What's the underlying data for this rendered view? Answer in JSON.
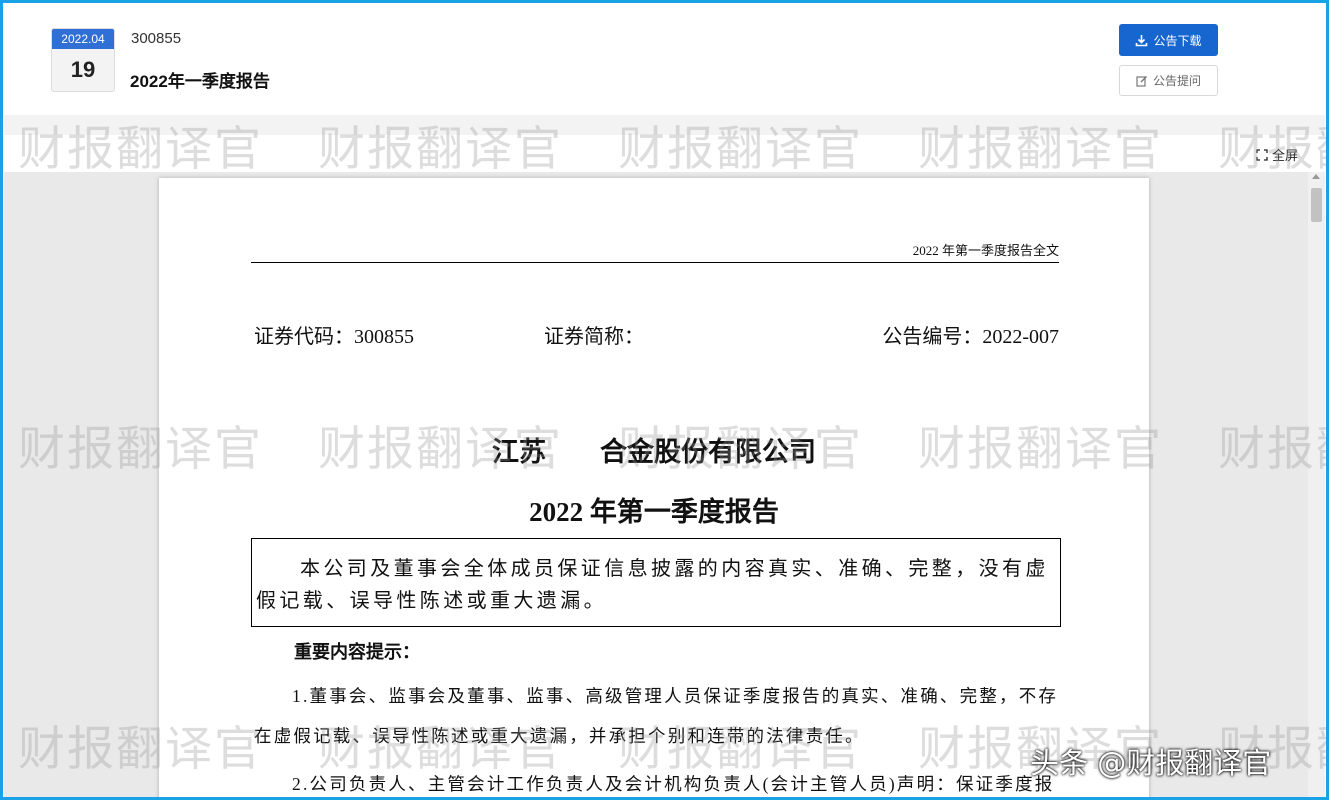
{
  "header": {
    "date_ym": "2022.04",
    "date_day": "19",
    "stock_code": "300855",
    "report_title": "2022年一季度报告",
    "download_label": "公告下载",
    "question_label": "公告提问",
    "fullscreen_label": "全屏"
  },
  "document": {
    "running_head": "2022 年第一季度报告全文",
    "security_code": "证券代码：300855",
    "security_abbr": "证券简称：",
    "announcement_no": "公告编号：2022-007",
    "company_part1": "江苏",
    "company_part2": "合金股份有限公司",
    "title": "2022 年第一季度报告",
    "notice": "本公司及董事会全体成员保证信息披露的内容真实、准确、完整，没有虚假记载、误导性陈述或重大遗漏。",
    "section_title": "重要内容提示：",
    "item1": "1.董事会、监事会及董事、监事、高级管理人员保证季度报告的真实、准确、完整，不存在虚假记载、误导性陈述或重大遗漏，并承担个别和连带的法律责任。",
    "item2": "2.公司负责人、主管会计工作负责人及会计机构负责人(会计主管人员)声明：保证季度报"
  },
  "watermark": {
    "text": "财报翻译官",
    "attribution": "头条 @财报翻译官"
  },
  "icons": [
    "download-icon",
    "edit-icon",
    "fullscreen-icon"
  ],
  "colors": {
    "accent": "#1766d0",
    "date_badge": "#2f6fd6",
    "frame": "#1aa1e6"
  }
}
